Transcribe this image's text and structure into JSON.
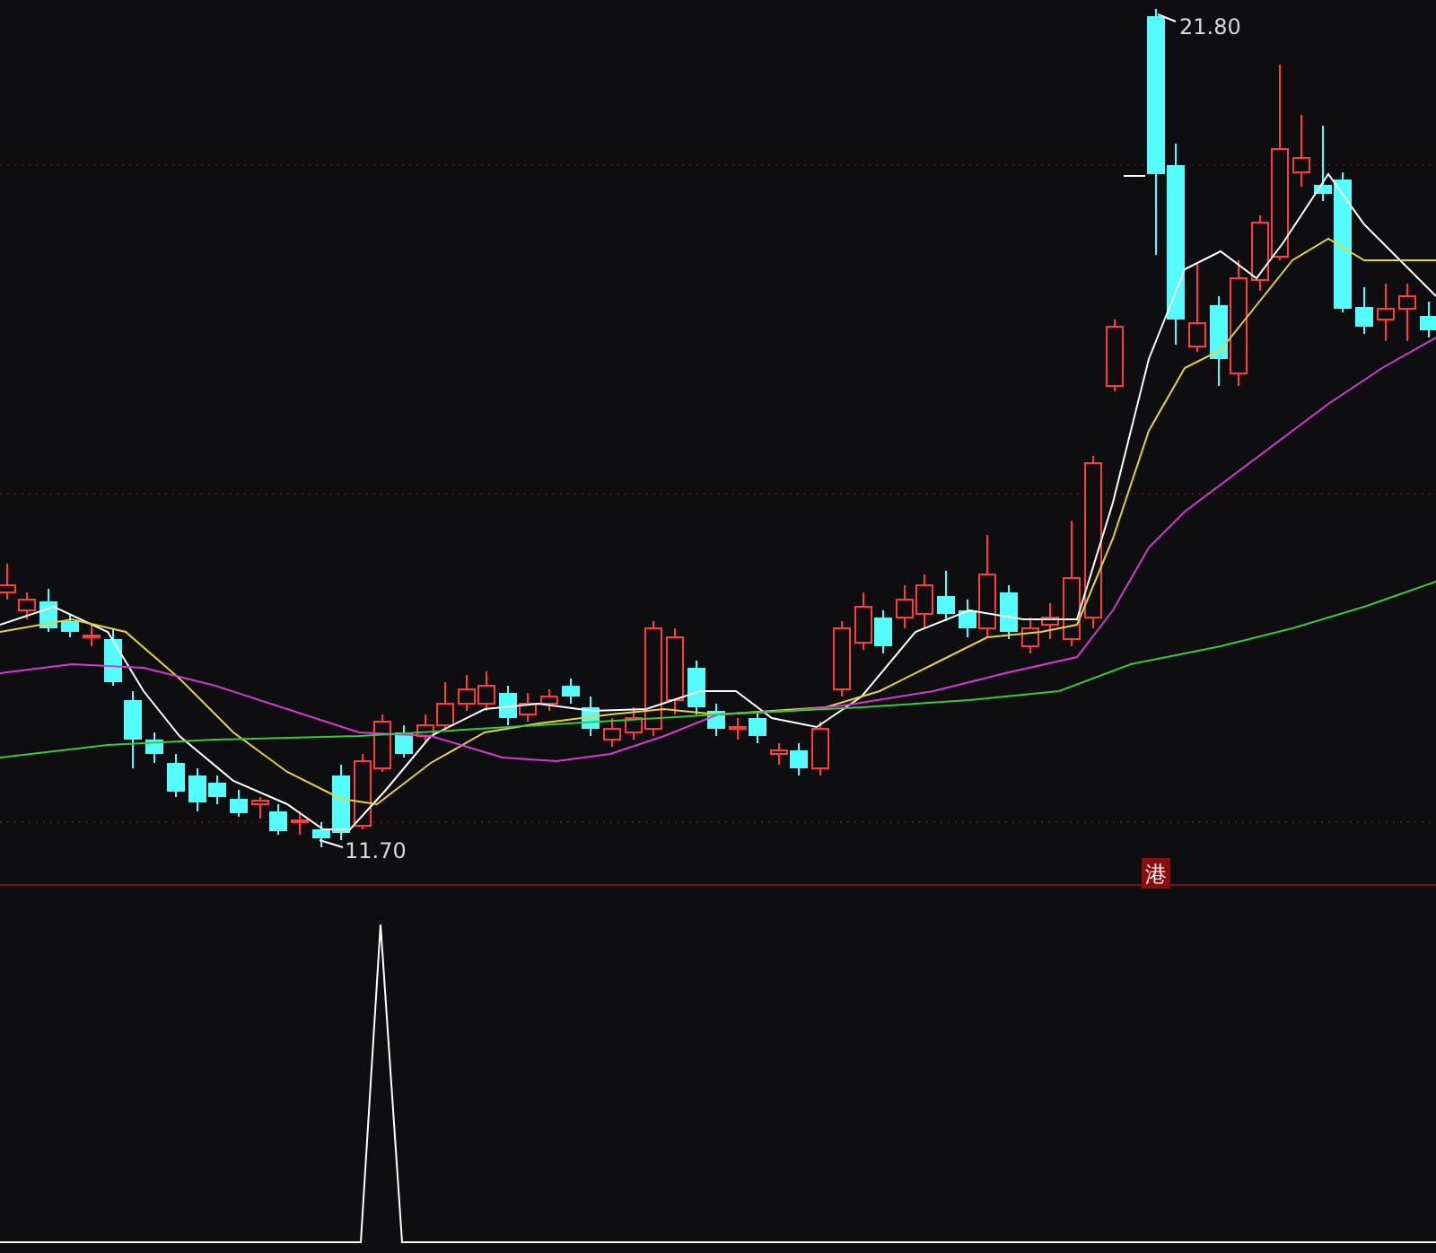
{
  "price_labels": [
    {
      "kind": "high",
      "text": "21.80"
    },
    {
      "kind": "low",
      "text": "11.70"
    }
  ],
  "badge": {
    "text": "港"
  }
}
